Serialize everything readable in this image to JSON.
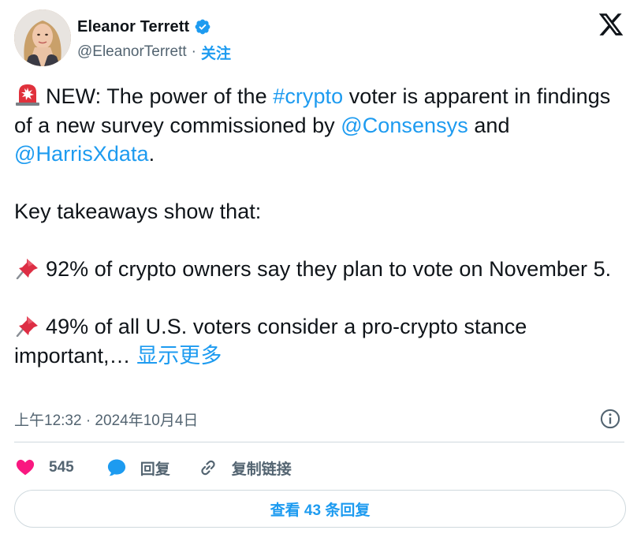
{
  "author": {
    "display_name": "Eleanor Terrett",
    "handle": "@EleanorTerrett",
    "separator": "·",
    "follow_label": "关注",
    "verified": true
  },
  "tweet": {
    "line1_prefix": "NEW: The power of the ",
    "hashtag": "#crypto",
    "line1_suffix": " voter is apparent in findings of a new survey commissioned by ",
    "mention1": "@Consensys",
    "and_text": " and ",
    "mention2": "@HarrisXdata",
    "period": ".",
    "para2": "Key takeaways show that:",
    "para3": "92% of crypto owners say they plan to vote on November 5.",
    "para4": "49% of all U.S. voters consider a pro-crypto stance important,…",
    "show_more": "显示更多"
  },
  "meta": {
    "timestamp": "上午12:32 · 2024年10月4日"
  },
  "actions": {
    "like_count": "545",
    "reply_label": "回复",
    "copy_link_label": "复制链接"
  },
  "more_replies_label": "查看 43 条回复",
  "colors": {
    "accent": "#1d9bf0",
    "like": "#f91880",
    "text": "#0f1419",
    "muted": "#536471",
    "border": "#cfd9de"
  },
  "icons": [
    "x-logo-icon",
    "verified-badge-icon",
    "siren-emoji-icon",
    "pushpin-emoji-icon",
    "info-icon",
    "heart-icon",
    "reply-bubble-icon",
    "link-icon"
  ]
}
